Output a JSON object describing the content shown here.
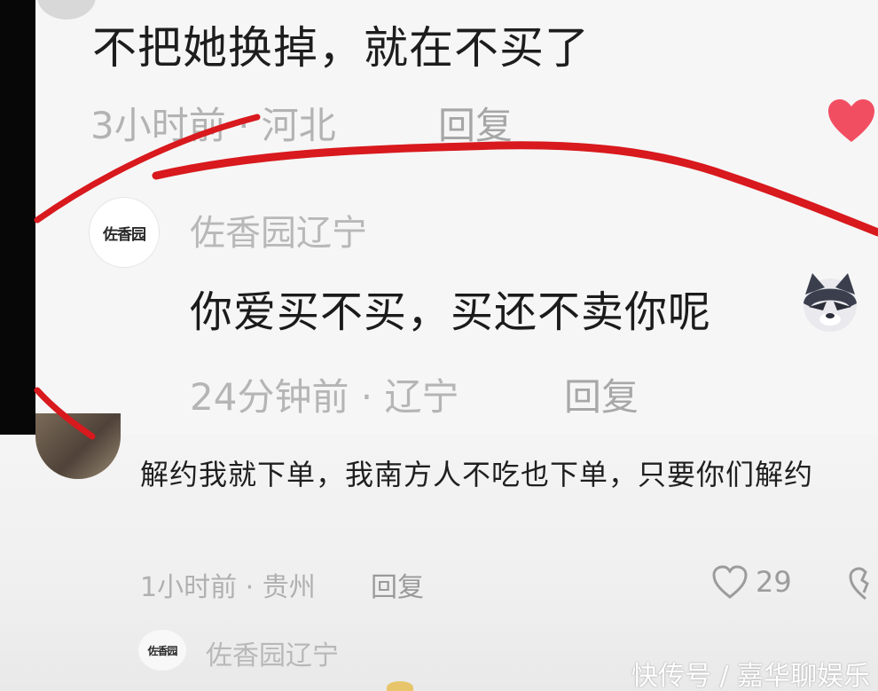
{
  "comment1": {
    "text": "不把她换掉，就在不买了",
    "time_location": "3小时前 · 河北",
    "reply_label": "回复",
    "liked_icon": "heart-filled-icon",
    "heart_color": "#f24e62"
  },
  "comment2": {
    "avatar_text": "佐香园",
    "username": "佐香园辽宁",
    "text": "你爱买不买，买还不卖你呢",
    "emoji": "wolf-emoji",
    "time_location": "24分钟前 · 辽宁",
    "reply_label": "回复"
  },
  "comment3": {
    "text": "解约我就下单，我南方人不吃也下单，只要你们解约",
    "time_location": "1小时前 · 贵州",
    "reply_label": "回复",
    "like_count": "29",
    "like_icon": "heart-outline-icon",
    "dislike_icon": "broken-heart-icon"
  },
  "comment4": {
    "avatar_text": "佐香园",
    "username": "佐香园辽宁"
  },
  "watermark": "快传号 / 嘉华聊娱乐",
  "colors": {
    "annotation_red": "#d8191d",
    "muted_text": "#b3b3b3"
  }
}
